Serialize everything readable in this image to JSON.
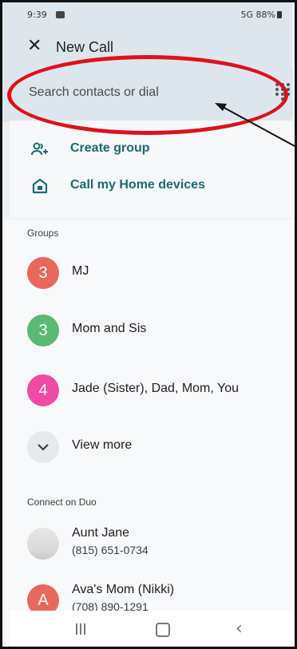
{
  "status_bar": {
    "time": "9:39",
    "right_status": "5G 88%"
  },
  "app_bar": {
    "close_glyph": "✕",
    "title": "New Call"
  },
  "search": {
    "placeholder": "Search contacts or dial",
    "dialpad_icon": "dialpad-icon"
  },
  "actions": [
    {
      "label": "Create group",
      "icon": "add-group-icon"
    },
    {
      "label": "Call my Home devices",
      "icon": "home-device-icon"
    }
  ],
  "groups": {
    "heading": "Groups",
    "items": [
      {
        "count": "3",
        "name": "MJ",
        "color": "#e8685c"
      },
      {
        "count": "3",
        "name": "Mom and Sis",
        "color": "#5bb974"
      },
      {
        "count": "4",
        "name": "Jade (Sister), Dad, Mom, You",
        "color": "#f14aa6"
      }
    ],
    "view_more": "View more"
  },
  "duo": {
    "heading": "Connect on Duo",
    "contacts": [
      {
        "name": "Aunt Jane",
        "phone": "(815) 651-0734"
      },
      {
        "initial": "A",
        "name": "Ava's Mom (Nikki)",
        "phone": "(708) 890-1291",
        "color": "#e8685c"
      }
    ]
  },
  "colors": {
    "accent": "#1a6b73",
    "annotation": "#e0101a",
    "search_bg": "#dde6ec"
  }
}
